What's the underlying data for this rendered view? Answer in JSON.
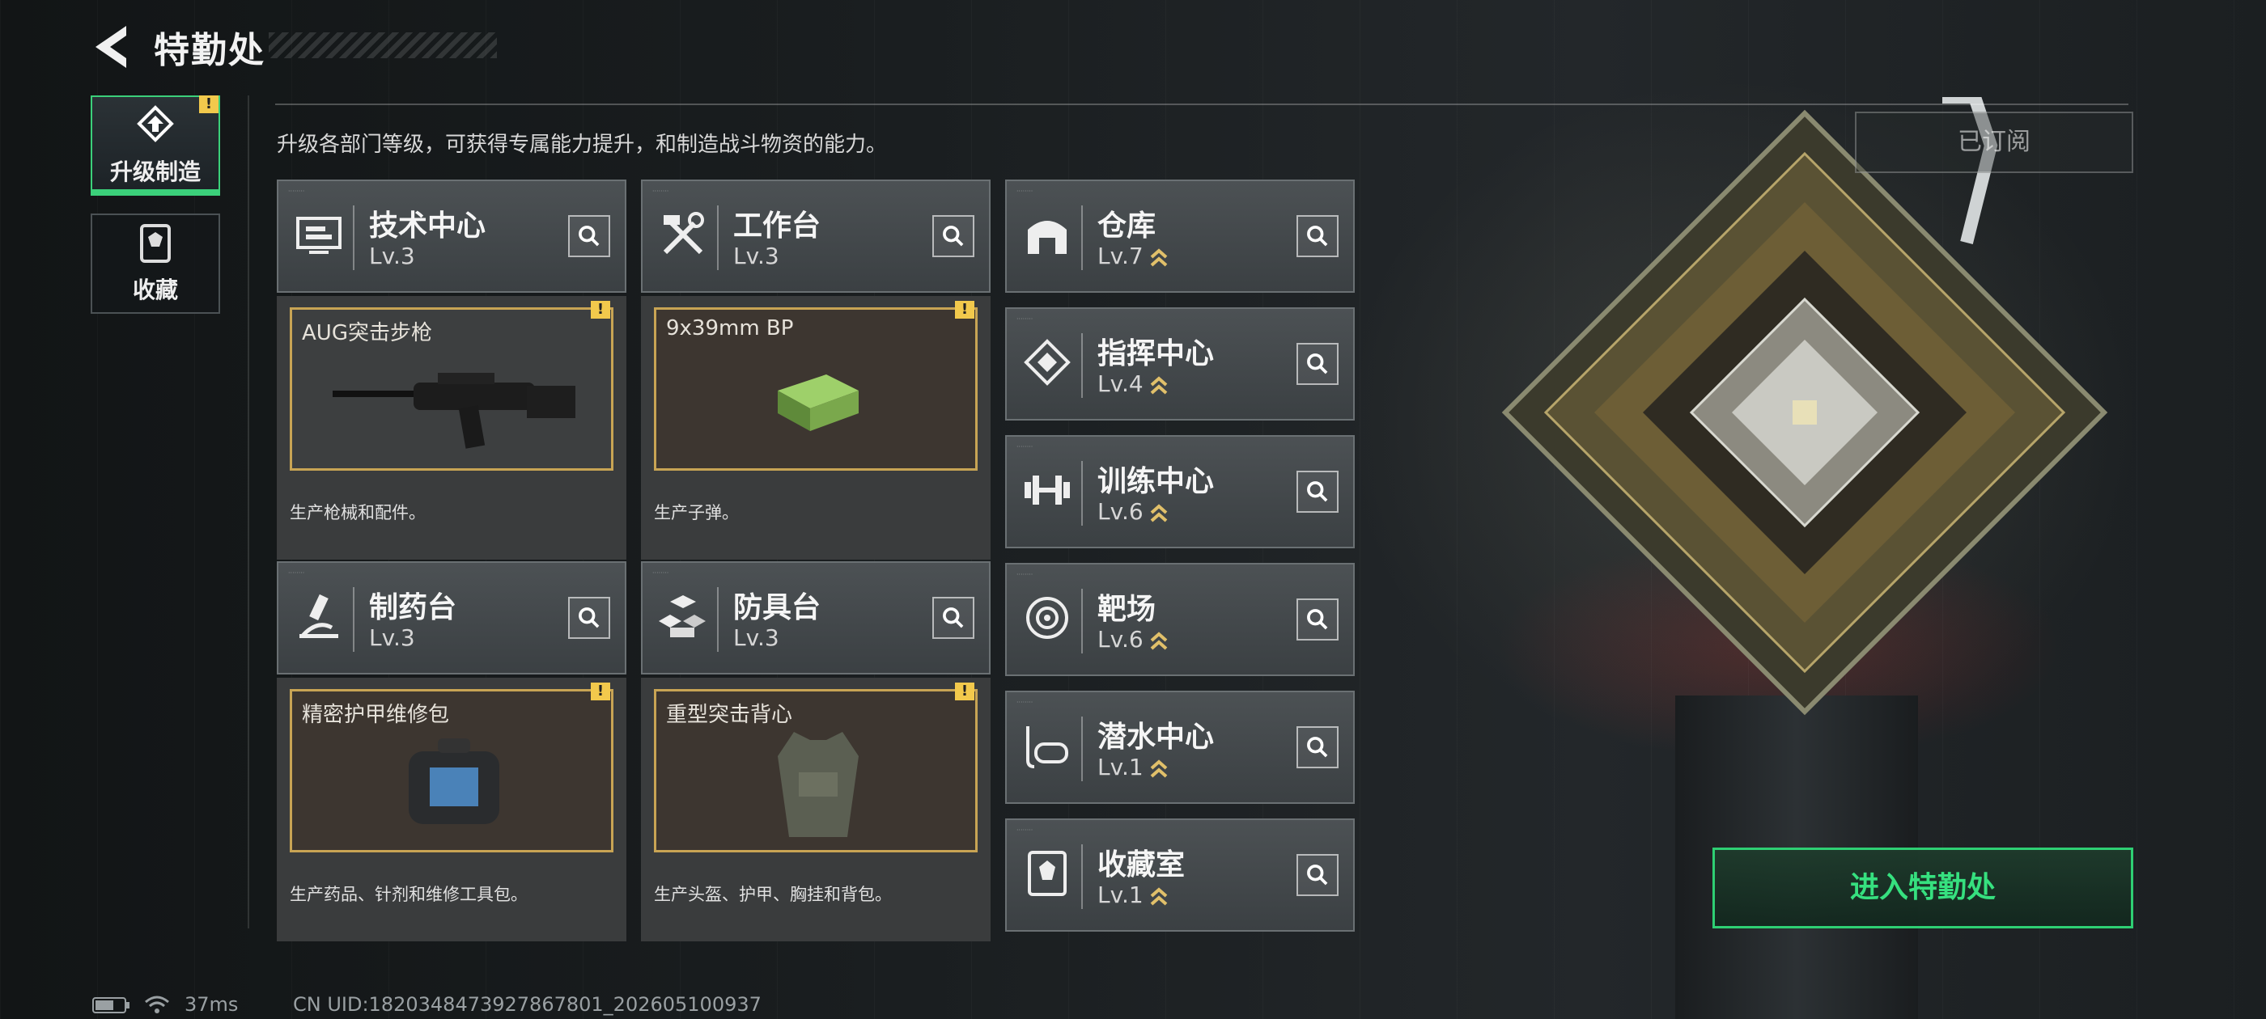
{
  "header": {
    "title": "特勤处",
    "subtitle": "升级各部门等级，可获得专属能力提升，和制造战斗物资的能力。"
  },
  "left_tabs": [
    {
      "label": "升级制造",
      "icon": "upgrade-craft-icon",
      "active": true,
      "warning": "!"
    },
    {
      "label": "收藏",
      "icon": "collection-icon",
      "active": false
    }
  ],
  "subscribed_label": "已订阅",
  "enter_label": "进入特勤处",
  "cards": [
    {
      "name": "技术中心",
      "level": "Lv.3",
      "icon": "tech-center-icon",
      "product": "AUG突击步枪",
      "product_icon": "rifle-icon",
      "desc": "生产枪械和配件。",
      "warning": "!"
    },
    {
      "name": "工作台",
      "level": "Lv.3",
      "icon": "workbench-icon",
      "product": "9x39mm BP",
      "product_icon": "ammo-box-icon",
      "desc": "生产子弹。",
      "warning": "!"
    },
    {
      "name": "制药台",
      "level": "Lv.3",
      "icon": "pharmacy-icon",
      "product": "精密护甲维修包",
      "product_icon": "repair-kit-icon",
      "desc": "生产药品、针剂和维修工具包。",
      "warning": "!"
    },
    {
      "name": "防具台",
      "level": "Lv.3",
      "icon": "armor-bench-icon",
      "product": "重型突击背心",
      "product_icon": "vest-icon",
      "desc": "生产头盔、护甲、胸挂和背包。",
      "warning": "!"
    }
  ],
  "side_cards": [
    {
      "name": "仓库",
      "level": "Lv.7",
      "icon": "warehouse-icon"
    },
    {
      "name": "指挥中心",
      "level": "Lv.4",
      "icon": "command-center-icon"
    },
    {
      "name": "训练中心",
      "level": "Lv.6",
      "icon": "training-center-icon"
    },
    {
      "name": "靶场",
      "level": "Lv.6",
      "icon": "shooting-range-icon"
    },
    {
      "name": "潜水中心",
      "level": "Lv.1",
      "icon": "diving-center-icon"
    },
    {
      "name": "收藏室",
      "level": "Lv.1",
      "icon": "collection-room-icon"
    }
  ],
  "status_bar": {
    "ping": "37ms",
    "uid": "CN UID:1820348473927867801_202605100937"
  },
  "colors": {
    "accent_green": "#3bd07a",
    "gold": "#c8a454",
    "warning": "#f2c94c"
  }
}
